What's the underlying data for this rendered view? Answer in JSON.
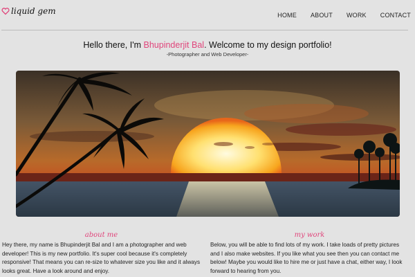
{
  "header": {
    "logo_text": "liquid gem",
    "logo_icon": "heart-icon",
    "nav": [
      "HOME",
      "ABOUT",
      "WORK",
      "CONTACT"
    ]
  },
  "hero": {
    "greeting_pre": "Hello there, I'm ",
    "name": "Bhupinderjit Bal",
    "greeting_post": ". Welcome to my design portfolio!",
    "tagline": "-Photographer and Web Developer-"
  },
  "about": {
    "title": "about me",
    "body": "Hey there, my name is Bhupinderjit Bal and I am a photographer and web developer! This is my new portfolio. It's super cool because it's completely responsive! That means you can re-size to whatever size you like and it always looks great. Have a look around and enjoy."
  },
  "work": {
    "title": "my work",
    "body": "Below, you will be able to find lots of my work. I take loads of pretty pictures and I also make websites. If you like what you see then you can contact me below! Maybe you would like to hire me or just have a chat, either way, I look forward to hearing from you."
  },
  "colors": {
    "accent": "#e0457b",
    "background": "#e3e3e3"
  }
}
